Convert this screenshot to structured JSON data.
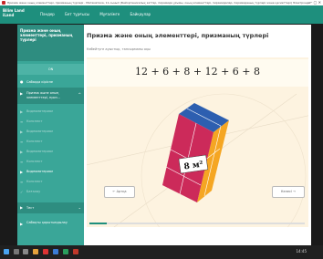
{
  "browser": {
    "title": "Призма және оның элементтері, призманың түрлері - Математика, 11-сынып (Бейорганикалық заттар, пирамида ұғымы, оның элементтері, пирамидалар, пирамиданың түрлері және қасиеттері) Электронды"
  },
  "header": {
    "logo_line1": "Bilim Land",
    "logo_line2": "iLand",
    "nav": [
      "Пәндер",
      "Бет тұрғысы",
      "Мұғалімге",
      "Байқаулар"
    ]
  },
  "sidebar": {
    "title": "Призма және оның элементтері, призманың түрлері",
    "section_label": "ON",
    "items": [
      {
        "label": "Сабаққа кіріспе",
        "state": "normal"
      },
      {
        "label": "Призма және оның элементтері, приз...",
        "state": "expanded"
      },
      {
        "label": "Видеоматериал",
        "state": "faded"
      },
      {
        "label": "Конспект",
        "state": "faded"
      },
      {
        "label": "Видеоматериал",
        "state": "faded"
      },
      {
        "label": "Конспект",
        "state": "faded"
      },
      {
        "label": "Видеоматериал",
        "state": "faded"
      },
      {
        "label": "Конспект",
        "state": "faded"
      },
      {
        "label": "Видеоматериал",
        "state": "bright"
      },
      {
        "label": "Конспект",
        "state": "faded"
      },
      {
        "label": "Бағалау",
        "state": "faded"
      }
    ],
    "test_label": "Тест",
    "footer_label": "Сабақты қорытындылау"
  },
  "main": {
    "title": "Призма және оның элементтері, призманың түрлері",
    "instruction": "Көбейтуге ауыстыр, тапсырманы оқы",
    "formula": "12 + 6 + 8 + 12 + 6 + 8",
    "area_label": "8 м²",
    "progress": 0.08,
    "back_label": "Артқа",
    "next_label": "Келесі"
  },
  "taskbar": {
    "time": "14:45",
    "date": "..."
  },
  "colors": {
    "accent": "#1e8f7d",
    "sidebar": "#3aa698",
    "stage_bg": "#fdf3e0",
    "prism_front": "#cc2a5a",
    "prism_side": "#f5a623",
    "prism_top": "#2d5fb0"
  }
}
